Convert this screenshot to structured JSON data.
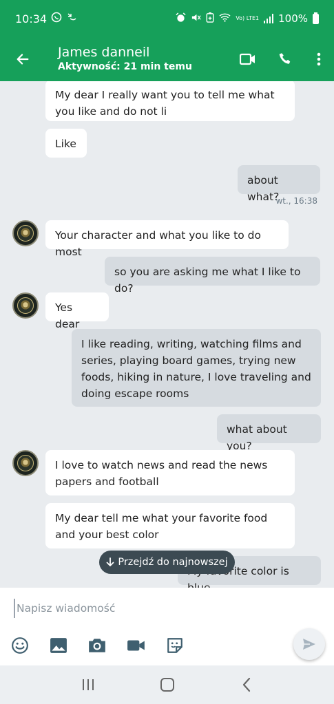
{
  "status_bar": {
    "time": "10:34",
    "battery": "100%",
    "network_label": "Vo) LTE1"
  },
  "header": {
    "contact_name": "James danneil",
    "contact_status": "Aktywność: 21 min temu"
  },
  "messages": [
    {
      "direction": "in",
      "text": "My dear I really want you to tell me what you like and do not li"
    },
    {
      "direction": "in",
      "text": "Like"
    },
    {
      "direction": "out",
      "text": "about what?"
    },
    {
      "direction": "in",
      "text": "Your character and what you like to do most"
    },
    {
      "direction": "out",
      "text": "so you are asking me what I like to do?"
    },
    {
      "direction": "in",
      "text": "Yes dear"
    },
    {
      "direction": "out",
      "text": "I like reading, writing, watching films and series, playing board games, trying new foods, hiking in nature, I love traveling and doing escape rooms"
    },
    {
      "direction": "out",
      "text": "what about you?"
    },
    {
      "direction": "in",
      "text": "I love to watch news and read the news papers and football"
    },
    {
      "direction": "in",
      "text": "My dear tell me what your favorite food and your best color"
    },
    {
      "direction": "out",
      "text": "My favorite color is blue"
    }
  ],
  "timestamps": {
    "about_what": "wt., 16:38"
  },
  "jump_to_latest": "Przejdź do najnowszej",
  "composer": {
    "placeholder": "Napisz wiadomość"
  },
  "colors": {
    "accent": "#16a05a",
    "incoming_bubble": "#ffffff",
    "outgoing_bubble": "#d6dbe0",
    "background": "#e9ecef"
  }
}
